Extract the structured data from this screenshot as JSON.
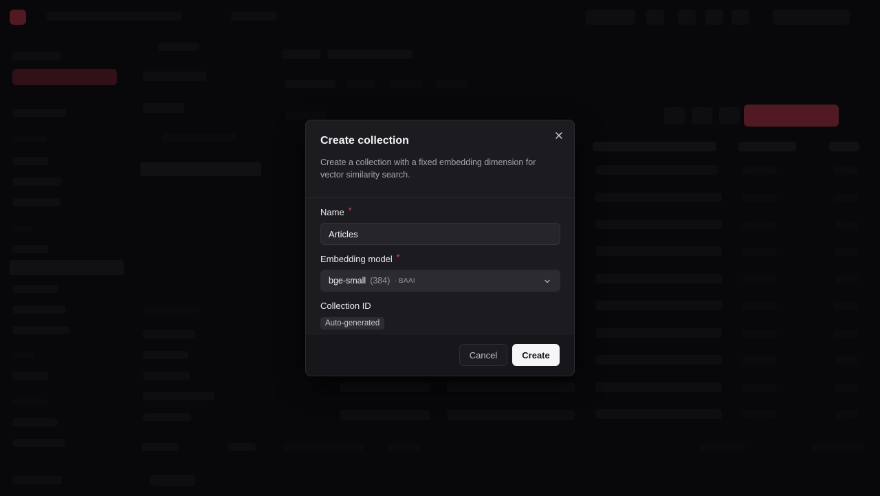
{
  "modal": {
    "title": "Create collection",
    "description": "Create a collection with a fixed embedding dimension for vector similarity search.",
    "name_field": {
      "label": "Name",
      "required_mark": "*",
      "value": "Articles"
    },
    "model_field": {
      "label": "Embedding model",
      "required_mark": "*",
      "selected_model": "bge-small",
      "selected_dim": "(384)",
      "selected_org": "· BAAI"
    },
    "id_field": {
      "label": "Collection ID",
      "badge": "Auto-generated"
    },
    "buttons": {
      "cancel": "Cancel",
      "create": "Create"
    }
  },
  "colors": {
    "accent": "#c8374f",
    "required": "#e0475f",
    "modal_bg": "#1c1b20"
  },
  "icons": {
    "close": "close-icon",
    "chevron": "chevron-down-icon"
  }
}
